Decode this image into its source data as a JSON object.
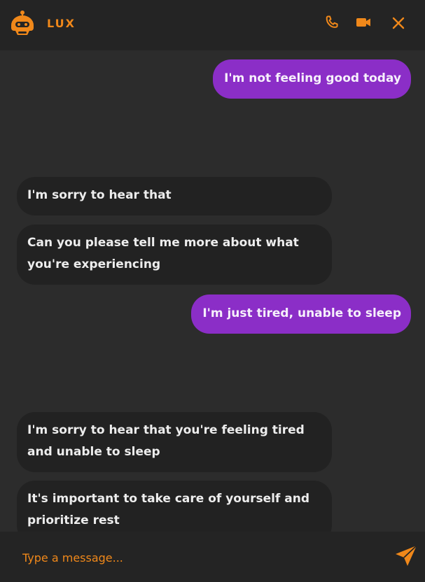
{
  "header": {
    "title": "LUX",
    "icons": [
      "robot-logo-icon",
      "phone-icon",
      "video-camera-icon",
      "close-icon"
    ]
  },
  "messages": [
    {
      "sender": "user",
      "text": "I'm not feeling good today"
    },
    {
      "sender": "bot",
      "text": "I'm sorry to hear that"
    },
    {
      "sender": "bot",
      "text": "Can you please tell me more about what you're experiencing"
    },
    {
      "sender": "user",
      "text": "I'm just tired, unable to sleep"
    },
    {
      "sender": "bot",
      "text": "I'm sorry to hear that you're feeling tired and unable to sleep"
    },
    {
      "sender": "bot",
      "text": "It's important to take care of yourself and prioritize rest"
    }
  ],
  "composer": {
    "placeholder": "Type a message...",
    "send_icon": "send-icon"
  },
  "colors": {
    "accent": "#f0881a",
    "user_bubble": "#8b2ec7",
    "bot_bubble": "#222222",
    "background": "#2c2c2c",
    "header": "#242424"
  }
}
